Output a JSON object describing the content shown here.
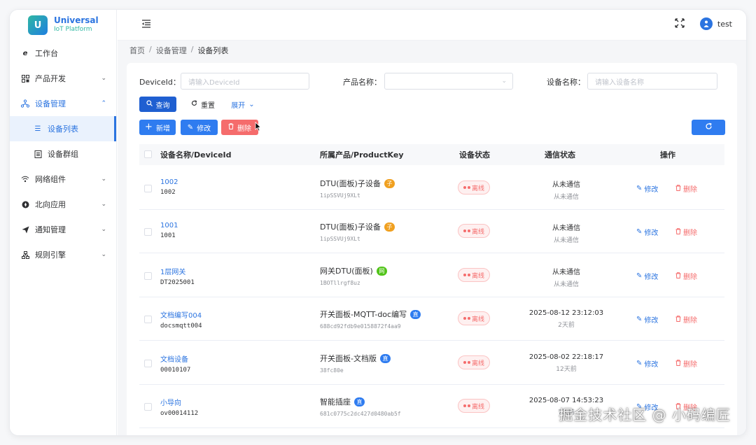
{
  "brand": {
    "logo_letter": "U",
    "name": "Universal",
    "sub": "IoT Platform"
  },
  "sidebar": {
    "items": [
      {
        "label": "工作台",
        "icon": "e-icon"
      },
      {
        "label": "产品开发",
        "icon": "grid-icon"
      },
      {
        "label": "设备管理",
        "icon": "network-icon"
      },
      {
        "label": "设备列表",
        "icon": "list-icon"
      },
      {
        "label": "设备群组",
        "icon": "group-icon"
      },
      {
        "label": "网络组件",
        "icon": "wifi-icon"
      },
      {
        "label": "北向应用",
        "icon": "compass-icon"
      },
      {
        "label": "通知管理",
        "icon": "send-icon"
      },
      {
        "label": "规则引擎",
        "icon": "tree-icon"
      }
    ]
  },
  "header": {
    "username": "test"
  },
  "breadcrumb": {
    "home": "首页",
    "section": "设备管理",
    "current": "设备列表",
    "separator": "/"
  },
  "search": {
    "deviceid_label": "DeviceId：",
    "deviceid_placeholder": "请输入DeviceId",
    "product_label": "产品名称：",
    "product_placeholder": "",
    "devname_label": "设备名称：",
    "devname_placeholder": "请输入设备名称",
    "query": "查询",
    "reset": "重置",
    "expand": "展开"
  },
  "toolbar": {
    "add": "新增",
    "edit": "修改",
    "delete": "删除"
  },
  "table": {
    "headers": [
      "设备名称/DeviceId",
      "所属产品/ProductKey",
      "设备状态",
      "通信状态",
      "操作"
    ],
    "edit_label": "修改",
    "delete_label": "删除",
    "rows": [
      {
        "name": "1002",
        "device_id": "1002",
        "product": "DTU(面板)子设备",
        "tag": "子",
        "tag_color": "#f0a020",
        "product_key": "1ipSSVUj9XLt",
        "status": "离线",
        "comm_main": "从未通信",
        "comm_sub": "从未通信"
      },
      {
        "name": "1001",
        "device_id": "1001",
        "product": "DTU(面板)子设备",
        "tag": "子",
        "tag_color": "#f0a020",
        "product_key": "1ipSSVUj9XLt",
        "status": "离线",
        "comm_main": "从未通信",
        "comm_sub": "从未通信"
      },
      {
        "name": "1层网关",
        "device_id": "DT2025001",
        "product": "网关DTU(面板)",
        "tag": "网",
        "tag_color": "#52c41a",
        "product_key": "1BOTllrgf8uz",
        "status": "离线",
        "comm_main": "从未通信",
        "comm_sub": "从未通信"
      },
      {
        "name": "文档编写004",
        "device_id": "docsmqtt004",
        "product": "开关面板-MQTT-doc编写",
        "tag": "直",
        "tag_color": "#2f7cf0",
        "product_key": "688cd92fdb9e0158872f4aa9",
        "status": "离线",
        "comm_main": "2025-08-12 23:12:03",
        "comm_sub": "2天前"
      },
      {
        "name": "文档设备",
        "device_id": "00010107",
        "product": "开关面板-文档版",
        "tag": "直",
        "tag_color": "#2f7cf0",
        "product_key": "38fc80e",
        "status": "离线",
        "comm_main": "2025-08-02 22:18:17",
        "comm_sub": "12天前"
      },
      {
        "name": "小导向",
        "device_id": "ov00014112",
        "product": "智能插座",
        "tag": "直",
        "tag_color": "#2f7cf0",
        "product_key": "681c0775c2dc427d0480ab5f",
        "status": "离线",
        "comm_main": "2025-08-07 14:53:23",
        "comm_sub": "7天前"
      }
    ]
  },
  "watermark": "掘金技术社区 @ 小码编匠",
  "colors": {
    "primary": "#2b74e0",
    "danger": "#f56c6c",
    "query_btn": "#1f5fd1"
  }
}
